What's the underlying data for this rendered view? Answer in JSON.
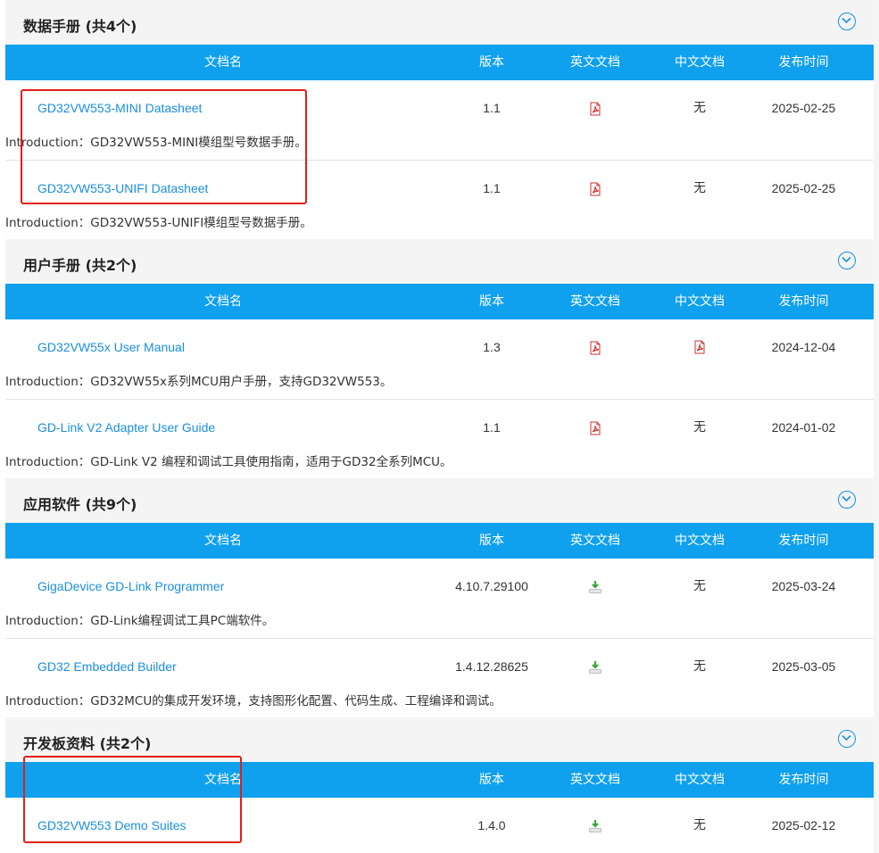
{
  "table_headers": {
    "name": "文档名",
    "version": "版本",
    "english_doc": "英文文档",
    "chinese_doc": "中文文档",
    "release_date": "发布时间"
  },
  "sections": [
    {
      "title": "数据手册 (共4个)",
      "rows": [
        {
          "name": "GD32VW553-MINI Datasheet",
          "version": "1.1",
          "en": "pdf-icon",
          "zh": "无",
          "date": "2025-02-25",
          "intro": "Introduction：GD32VW553-MINI模组型号数据手册。"
        },
        {
          "name": "GD32VW553-UNIFI Datasheet",
          "version": "1.1",
          "en": "pdf-icon",
          "zh": "无",
          "date": "2025-02-25",
          "intro": "Introduction：GD32VW553-UNIFI模组型号数据手册。"
        }
      ]
    },
    {
      "title": "用户手册 (共2个)",
      "rows": [
        {
          "name": "GD32VW55x User Manual",
          "version": "1.3",
          "en": "pdf-icon",
          "zh": "pdf-icon",
          "date": "2024-12-04",
          "intro": "Introduction：GD32VW55x系列MCU用户手册，支持GD32VW553。"
        },
        {
          "name": "GD-Link V2 Adapter User Guide",
          "version": "1.1",
          "en": "pdf-icon",
          "zh": "无",
          "date": "2024-01-02",
          "intro": "Introduction：GD-Link V2 编程和调试工具使用指南，适用于GD32全系列MCU。"
        }
      ]
    },
    {
      "title": "应用软件 (共9个)",
      "rows": [
        {
          "name": "GigaDevice GD-Link Programmer",
          "version": "4.10.7.29100",
          "en": "download-icon",
          "zh": "无",
          "date": "2025-03-24",
          "intro": "Introduction：GD-Link编程调试工具PC端软件。"
        },
        {
          "name": "GD32 Embedded Builder",
          "version": "1.4.12.28625",
          "en": "download-icon",
          "zh": "无",
          "date": "2025-03-05",
          "intro": "Introduction：GD32MCU的集成开发环境，支持图形化配置、代码生成、工程编译和调试。"
        }
      ]
    },
    {
      "title": "开发板资料 (共2个)",
      "rows": [
        {
          "name": "GD32VW553 Demo Suites",
          "version": "1.4.0",
          "en": "download-icon",
          "zh": "无",
          "date": "2025-02-12",
          "intro": ""
        }
      ]
    }
  ],
  "colors": {
    "header_blue": "#0fa0ee",
    "link_blue": "#1a8fe0",
    "highlight_red": "#e0201b",
    "pdf_red": "#d32f2f",
    "download_green": "#3aa93a"
  }
}
